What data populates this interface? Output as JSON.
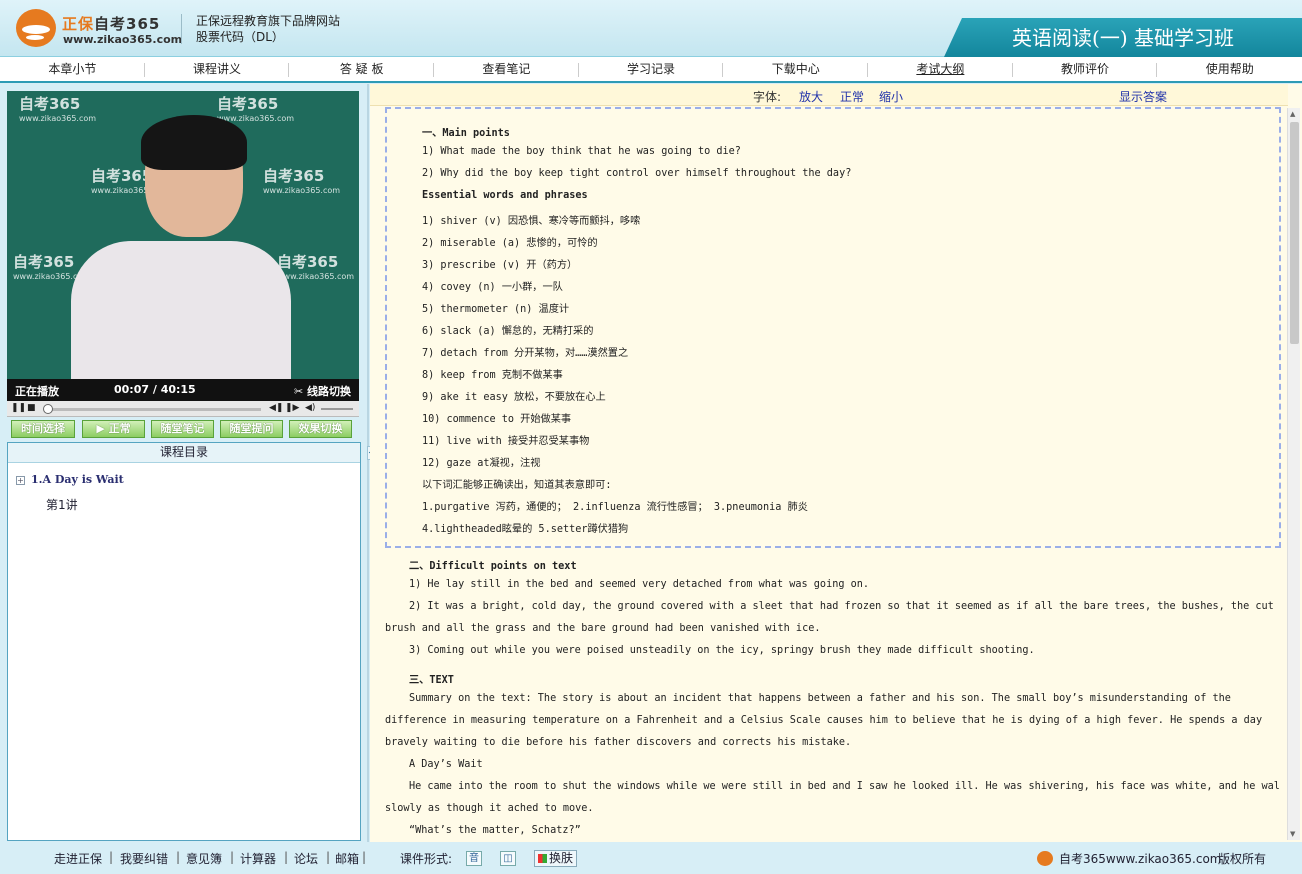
{
  "header": {
    "brand_cn": "正保",
    "brand_cn2": "自考365",
    "url": "www.zikao365.com",
    "tagline1": "正保远程教育旗下品牌网站",
    "tagline2": "股票代码（DL）",
    "course_title": "英语阅读(一) 基础学习班"
  },
  "nav": [
    "本章小节",
    "课程讲义",
    "答 疑 板",
    "查看笔记",
    "学习记录",
    "下载中心",
    "考试大纲",
    "教师评价",
    "使用帮助"
  ],
  "video": {
    "watermark": "自考365",
    "watermark_url": "www.zikao365.com",
    "status": "正在播放",
    "time": "00:07 / 40:15",
    "line_switch": "线路切换"
  },
  "buttons": [
    "时间选择",
    "正常",
    "随堂笔记",
    "随堂提问",
    "效果切换"
  ],
  "toc": {
    "title": "课程目录",
    "item": "1.A Day is Wait",
    "sub": "第1讲"
  },
  "fontbar": {
    "label": "字体:",
    "enlarge": "放大",
    "normal": "正常",
    "shrink": "缩小",
    "show_answer": "显示答案"
  },
  "content": {
    "boxed": [
      "一、Main points",
      "1)  What made the boy think that he was going to die?",
      "2)  Why did the boy keep tight control over himself throughout the day?",
      "Essential words and phrases",
      "1) shiver  (v)  因恐惧、寒冷等而颤抖，哆嗦",
      "2) miserable  (a) 悲惨的，可怜的",
      "3) prescribe  (v) 开（药方）",
      "4) covey (n) 一小群，一队",
      "5) thermometer  (n) 温度计",
      "6) slack  (a) 懈怠的，无精打采的",
      "7) detach from 分开某物，对……漠然置之",
      "8) keep from 克制不做某事",
      "9) ake it easy 放松，不要放在心上",
      "10) commence to 开始做某事",
      "11) live with 接受并忍受某事物",
      "12) gaze at凝视，注视",
      "以下词汇能够正确读出，知道其表意即可:",
      "1.purgative 泻药，通便的；  2.influenza 流行性感冒；  3.pneumonia 肺炎",
      "4.lightheaded眩晕的 5.setter蹲伏猎狗"
    ],
    "section2_title": "二、Difficult points on text",
    "section2": [
      "1) He lay still in the bed and seemed very detached from what was going on.",
      "2) It was a bright, cold day, the ground covered with a sleet that had frozen so that it seemed as if all the bare trees, the bushes, the cut",
      "brush and all the grass and the bare ground had been vanished with ice.",
      "3) Coming out while you were poised unsteadily on the icy, springy brush they made difficult shooting."
    ],
    "section3_title": "三、TEXT",
    "section3": [
      "Summary on the text: The story is about an incident that happens between a father and his son. The small boy’s misunderstanding of the",
      "difference in measuring temperature on a Fahrenheit and a Celsius Scale causes him to believe that he is dying of a high fever. He spends a day",
      "bravely waiting to die before his father discovers and corrects his mistake.",
      "A Day’s Wait",
      "He came into the room to shut the windows while we were still in bed and I saw he looked ill. He was shivering, his face was white, and he walked",
      "slowly as though it ached to move.",
      "“What’s the matter, Schatz?”"
    ]
  },
  "footer": {
    "links": [
      "走进正保",
      "我要纠错",
      "意见簿",
      "计算器",
      "论坛",
      "邮箱"
    ],
    "format_label": "课件形式:",
    "format_audio": "音",
    "skin": "换肤",
    "site": "自考365www.zikao365.com",
    "copyright": "版权所有"
  }
}
